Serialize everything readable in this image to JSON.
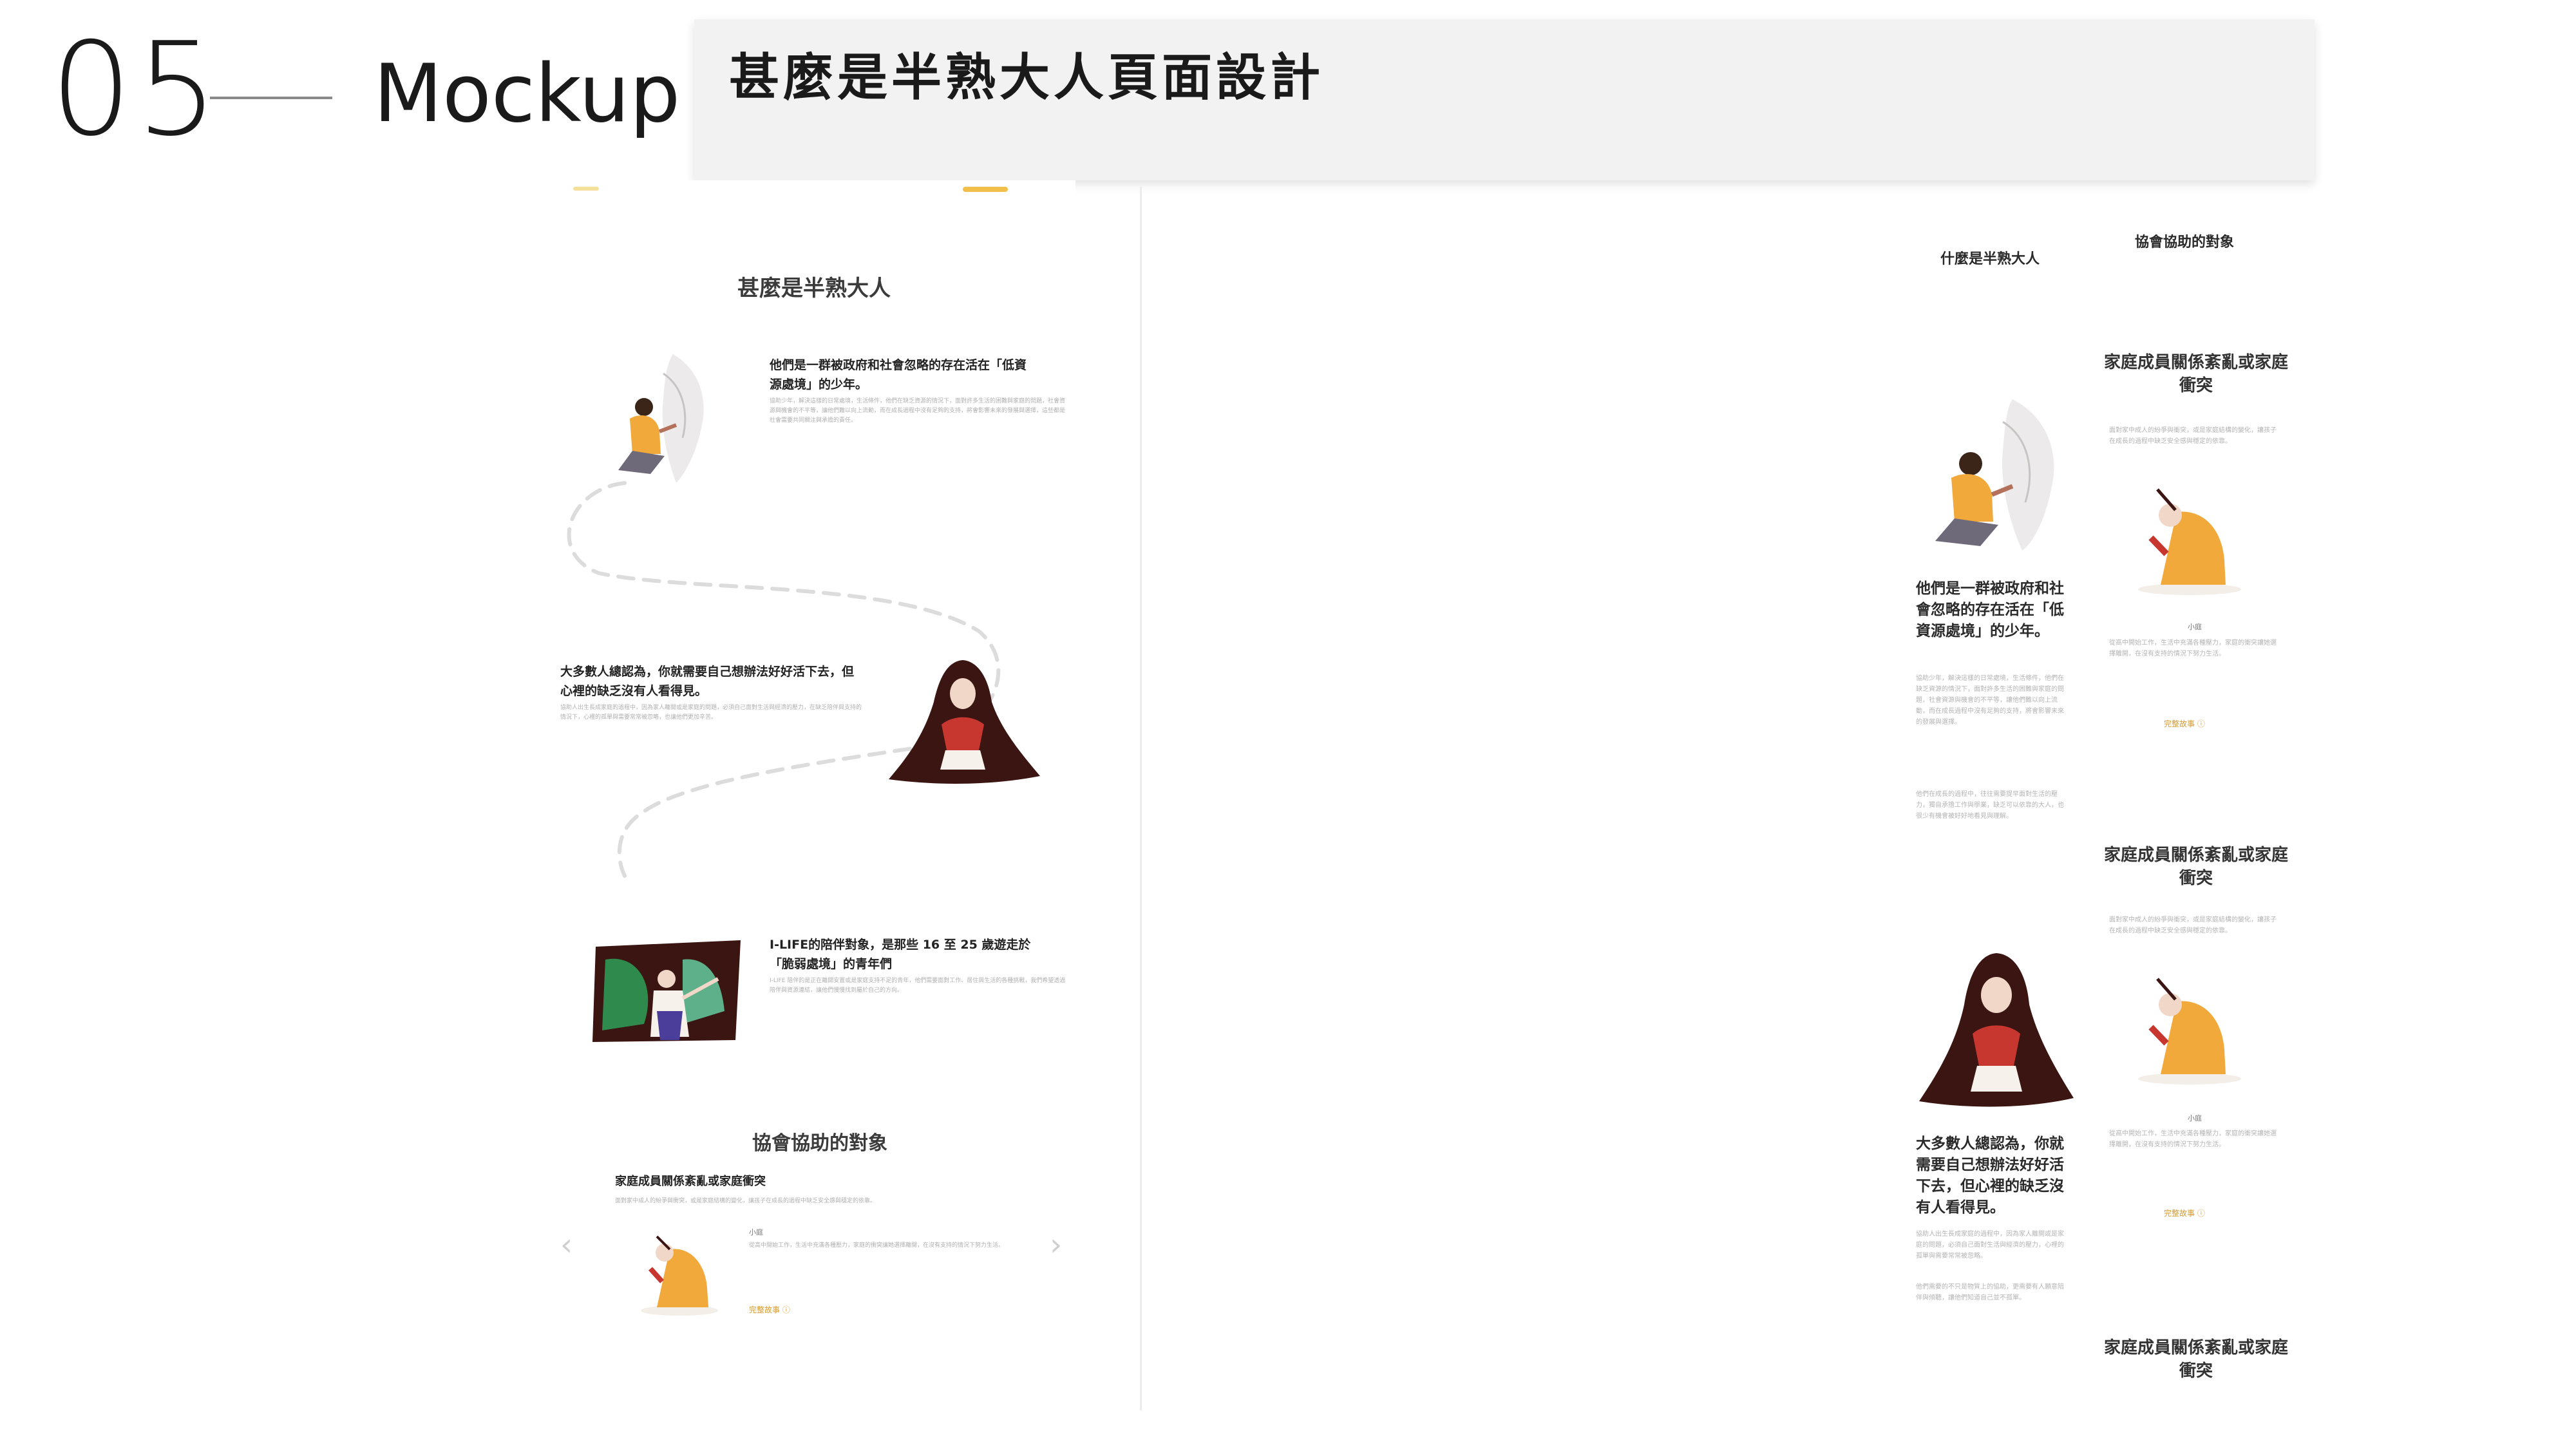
{
  "slide": {
    "number": "05",
    "title": "Mockup",
    "caption": "甚麼是半熟大人頁面設計"
  },
  "desktop": {
    "section_title": "甚麼是半熟大人",
    "block1": {
      "heading": "他們是一群被政府和社會忽略的存在活在「低資源處境」的少年。",
      "body": "協助少年，解決這樣的日常處境，生活條件，他們在缺乏資源的情況下，面對許多生活的困難與家庭的問題，社會資源與機會的不平等，讓他們難以向上流動，而在成長過程中沒有足夠的支持，將會影響未來的發展與選擇，這些都是社會需要共同關注與承擔的責任。"
    },
    "block2": {
      "heading": "大多數人總認為，你就需要自己想辦法好好活下去，但心裡的缺乏沒有人看得見。",
      "body": "協助人出生長成家庭的過程中，因為家人離開或是家庭的問題，必須自己面對生活與經濟的壓力，在缺乏陪伴與支持的情況下，心裡的孤單與需要常常被忽略，也讓他們更加辛苦。"
    },
    "block3": {
      "heading": "I-LIFE的陪伴對象，是那些 16 至 25 歲遊走於「脆弱處境」的青年們",
      "body": "I-LIFE 陪伴的是正在離開安置或是家庭支持不足的青年，他們需要面對工作、居住與生活的各種挑戰，我們希望透過陪伴與資源連結，讓他們慢慢找到屬於自己的方向。"
    },
    "section2_title": "協會協助的對象",
    "card": {
      "heading": "家庭成員關係紊亂或家庭衝突",
      "body": "面對家中成人的紛爭與衝突，或是家庭結構的變化，讓孩子在成長的過程中缺乏安全感與穩定的依靠。",
      "person_label": "小庭",
      "person_body": "從高中開始工作，生活中充滿各種壓力，家庭的衝突讓她選擇離開，在沒有支持的情況下努力生活。",
      "read_more": "完整故事 ⓘ"
    }
  },
  "mobile": {
    "col1_title": "什麼是半熟大人",
    "col2_title": "協會協助的對象",
    "block1_heading": "他們是一群被政府和社會忽略的存在活在「低資源處境」的少年。",
    "block1_body": "協助少年，解決這樣的日常處境，生活條件，他們在缺乏資源的情況下，面對許多生活的困難與家庭的問題，社會資源與機會的不平等，讓他們難以向上流動，而在成長過程中沒有足夠的支持，將會影響未來的發展與選擇。",
    "block1_body2": "他們在成長的過程中，往往需要提早面對生活的壓力，獨自承擔工作與學業，缺乏可以依靠的大人，也很少有機會被好好地看見與理解。",
    "block2_heading": "大多數人總認為，你就需要自己想辦法好好活下去，但心裡的缺乏沒有人看得見。",
    "block2_body": "協助人出生長成家庭的過程中，因為家人離開或是家庭的問題，必須自己面對生活與經濟的壓力，心裡的孤單與需要常常被忽略。",
    "block2_body2": "他們需要的不只是物質上的協助，更需要有人願意陪伴與傾聽，讓他們知道自己並不孤單。",
    "cat_heading": "家庭成員關係紊亂或家庭衝突",
    "cat_body": "面對家中成人的紛爭與衝突，或是家庭結構的變化，讓孩子在成長的過程中缺乏安全感與穩定的依靠。",
    "person_label": "小庭",
    "person_body": "從高中開始工作，生活中充滿各種壓力，家庭的衝突讓她選擇離開，在沒有支持的情況下努力生活。",
    "read_more": "完整故事 ⓘ"
  },
  "colors": {
    "accent": "#f2c04a",
    "caption_bg": "#f2f2f2",
    "illustration_orange": "#f2a93b",
    "illustration_dark": "#3a1512"
  }
}
